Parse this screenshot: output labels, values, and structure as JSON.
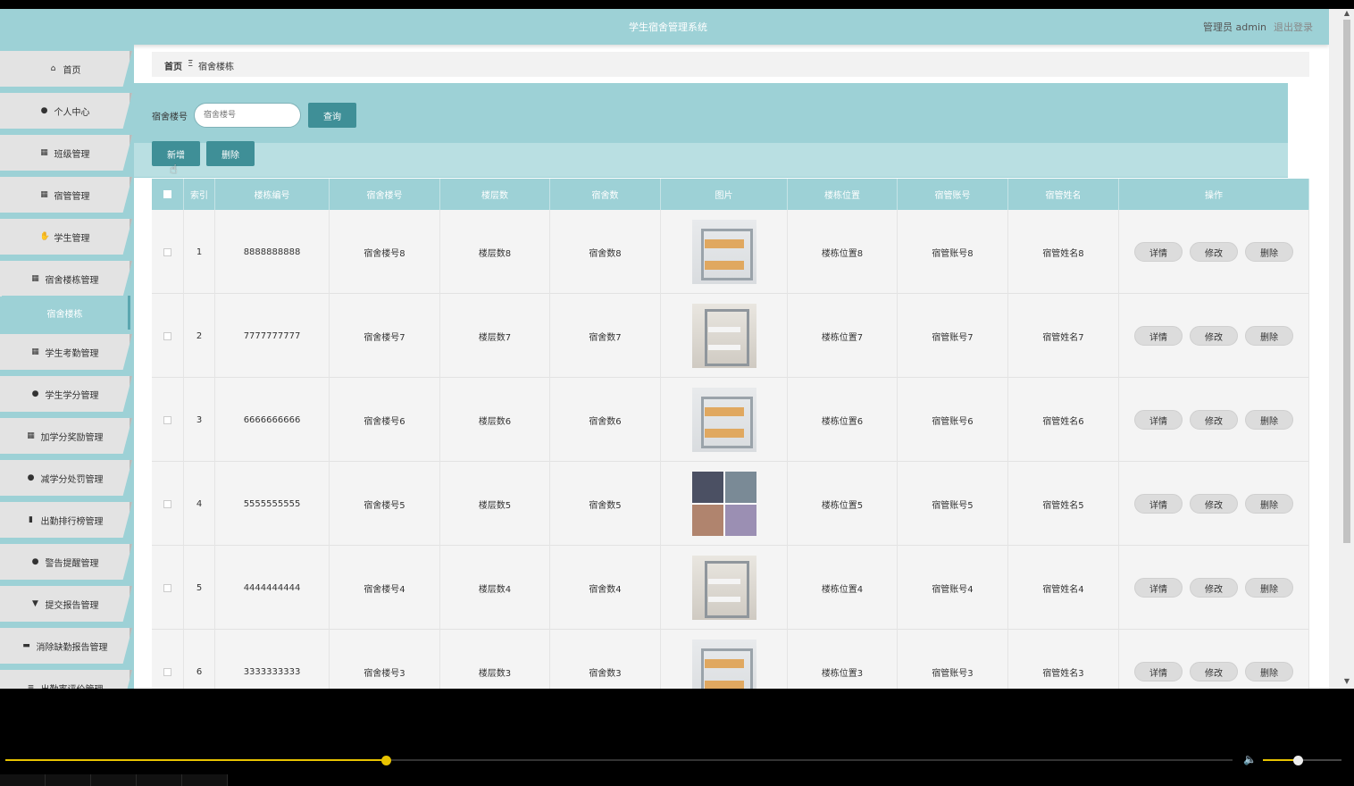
{
  "app": {
    "title": "学生宿舍管理系统",
    "admin_label": "管理员 admin",
    "logout_label": "退出登录"
  },
  "sidebar": {
    "items": [
      {
        "label": "首页",
        "icon": "home-icon",
        "glyph": "⌂"
      },
      {
        "label": "个人中心",
        "icon": "user-icon",
        "glyph": "●"
      },
      {
        "label": "班级管理",
        "icon": "grid-icon",
        "glyph": "▦"
      },
      {
        "label": "宿管管理",
        "icon": "grid-icon",
        "glyph": "▦"
      },
      {
        "label": "学生管理",
        "icon": "hand-icon",
        "glyph": "✋"
      },
      {
        "label": "宿舍楼栋管理",
        "icon": "grid-icon",
        "glyph": "▦"
      },
      {
        "label": "学生考勤管理",
        "icon": "grid-icon",
        "glyph": "▦"
      },
      {
        "label": "学生学分管理",
        "icon": "pin-icon",
        "glyph": "●"
      },
      {
        "label": "加学分奖励管理",
        "icon": "grid-icon",
        "glyph": "▦"
      },
      {
        "label": "减学分处罚管理",
        "icon": "user-icon",
        "glyph": "●"
      },
      {
        "label": "出勤排行榜管理",
        "icon": "clipboard-icon",
        "glyph": "▮"
      },
      {
        "label": "警告提醒管理",
        "icon": "user-icon",
        "glyph": "●"
      },
      {
        "label": "提交报告管理",
        "icon": "flag-icon",
        "glyph": "▼"
      },
      {
        "label": "消除缺勤报告管理",
        "icon": "monitor-icon",
        "glyph": "▬"
      },
      {
        "label": "出勤率评价管理",
        "icon": "list-icon",
        "glyph": "≡"
      }
    ],
    "active_sub": "宿舍楼栋"
  },
  "breadcrumb": {
    "home": "首页",
    "separator": "Ξ",
    "current": "宿舍楼栋"
  },
  "search": {
    "label": "宿舍楼号",
    "placeholder": "宿舍楼号",
    "button": "查询"
  },
  "actions": {
    "add": "新增",
    "delete": "删除"
  },
  "table": {
    "headers": [
      "索引",
      "楼栋编号",
      "宿舍楼号",
      "楼层数",
      "宿舍数",
      "图片",
      "楼栋位置",
      "宿管账号",
      "宿管姓名",
      "操作"
    ],
    "rows": [
      {
        "index": "1",
        "code": "8888888888",
        "building": "宿舍楼号8",
        "floors": "楼层数8",
        "rooms": "宿舍数8",
        "image": "bunk-bed-photo",
        "location": "楼栋位置8",
        "account": "宿管账号8",
        "name": "宿管姓名8"
      },
      {
        "index": "2",
        "code": "7777777777",
        "building": "宿舍楼号7",
        "floors": "楼层数7",
        "rooms": "宿舍数7",
        "image": "bunk-room-photo",
        "location": "楼栋位置7",
        "account": "宿管账号7",
        "name": "宿管姓名7"
      },
      {
        "index": "3",
        "code": "6666666666",
        "building": "宿舍楼号6",
        "floors": "楼层数6",
        "rooms": "宿舍数6",
        "image": "bunk-bed-photo",
        "location": "楼栋位置6",
        "account": "宿管账号6",
        "name": "宿管姓名6"
      },
      {
        "index": "4",
        "code": "5555555555",
        "building": "宿舍楼号5",
        "floors": "楼层数5",
        "rooms": "宿舍数5",
        "image": "room-collage-photo",
        "location": "楼栋位置5",
        "account": "宿管账号5",
        "name": "宿管姓名5"
      },
      {
        "index": "5",
        "code": "4444444444",
        "building": "宿舍楼号4",
        "floors": "楼层数4",
        "rooms": "宿舍数4",
        "image": "bunk-room-photo",
        "location": "楼栋位置4",
        "account": "宿管账号4",
        "name": "宿管姓名4"
      },
      {
        "index": "6",
        "code": "3333333333",
        "building": "宿舍楼号3",
        "floors": "楼层数3",
        "rooms": "宿舍数3",
        "image": "bunk-bed-photo",
        "location": "楼栋位置3",
        "account": "宿管账号3",
        "name": "宿管姓名3"
      }
    ],
    "row_actions": {
      "detail": "详情",
      "edit": "修改",
      "delete": "删除"
    }
  },
  "player": {
    "progress": 0.31,
    "volume": 0.44
  },
  "colors": {
    "accent": "#9dd1d6",
    "button": "#3f8f97",
    "progress": "#e8c300"
  }
}
